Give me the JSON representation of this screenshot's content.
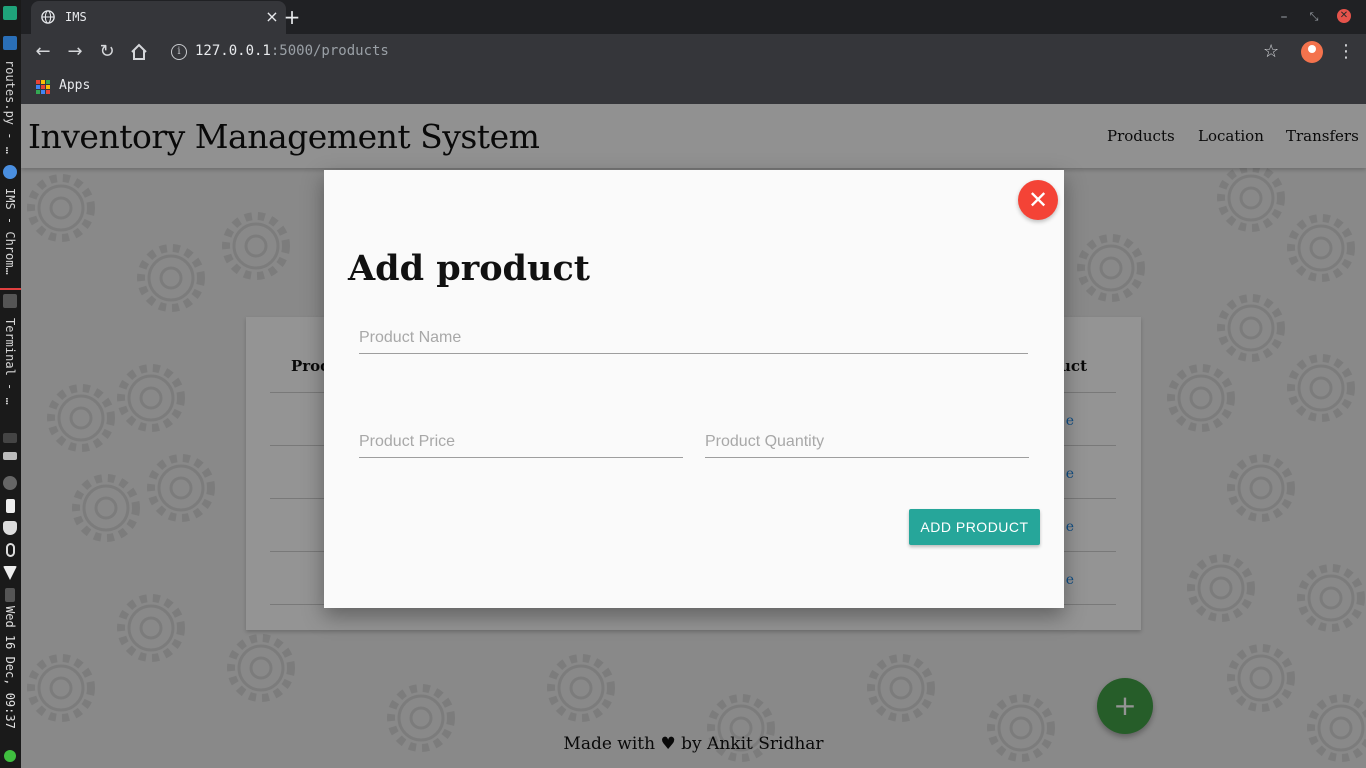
{
  "taskbar": {
    "items": [
      "routes.py - …",
      "IMS - Chrom…",
      "Terminal - …"
    ],
    "clock": "Wed 16 Dec, 09:37"
  },
  "browser": {
    "tab_title": "IMS",
    "url_host": "127.0.0.1",
    "url_path": ":5000/products",
    "bookmark_apps": "Apps",
    "colors": {
      "tab_bar": "#202124",
      "toolbar": "#35363a"
    }
  },
  "page": {
    "brand": "Inventory Management System",
    "nav": [
      "Products",
      "Location",
      "Transfers"
    ],
    "table": {
      "header_left_partial": "Prod",
      "header_right_partial": "uct",
      "row_link_partial": "e",
      "row_count": 4
    },
    "footer": {
      "prefix": "Made with",
      "heart": "♥",
      "suffix": "by Ankit Sridhar"
    },
    "fab_symbol": "+"
  },
  "modal": {
    "close_symbol": "✕",
    "title": "Add product",
    "fields": {
      "name_placeholder": "Product Name",
      "price_placeholder": "Product Price",
      "quantity_placeholder": "Product Quantity"
    },
    "submit_label": "ADD PRODUCT",
    "colors": {
      "close": "#f44336",
      "submit": "#26a69a",
      "fab": "#43a047"
    }
  }
}
